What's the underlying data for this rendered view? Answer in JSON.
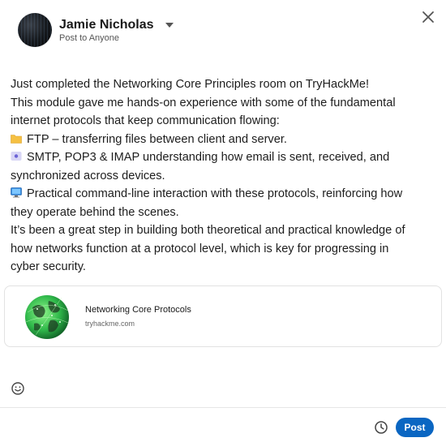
{
  "header": {
    "author_name": "Jamie Nicholas",
    "visibility": "Post to Anyone"
  },
  "post": {
    "lines": [
      "Just completed the Networking Core Principles room on TryHackMe!",
      "This module gave me hands-on experience with some of the fundamental",
      "internet protocols that keep communication flowing:",
      "FTP – transferring files between client and server.",
      "SMTP, POP3 & IMAP understanding how email is sent, received, and",
      "synchronized across devices.",
      "Practical command-line interaction with these protocols, reinforcing how",
      "they operate behind the scenes.",
      "It’s been a great step in building both theoretical and practical knowledge of",
      "how networks function at a protocol level, which is key for progressing in",
      "cyber security."
    ],
    "icons": {
      "line4": "folder-icon",
      "line5": "email-icon",
      "line7": "computer-icon"
    }
  },
  "link_card": {
    "title": "Networking Core Protocols",
    "domain": "tryhackme.com"
  },
  "footer": {
    "post_label": "Post"
  },
  "colors": {
    "primary": "#0a66c2",
    "text": "#191919"
  }
}
